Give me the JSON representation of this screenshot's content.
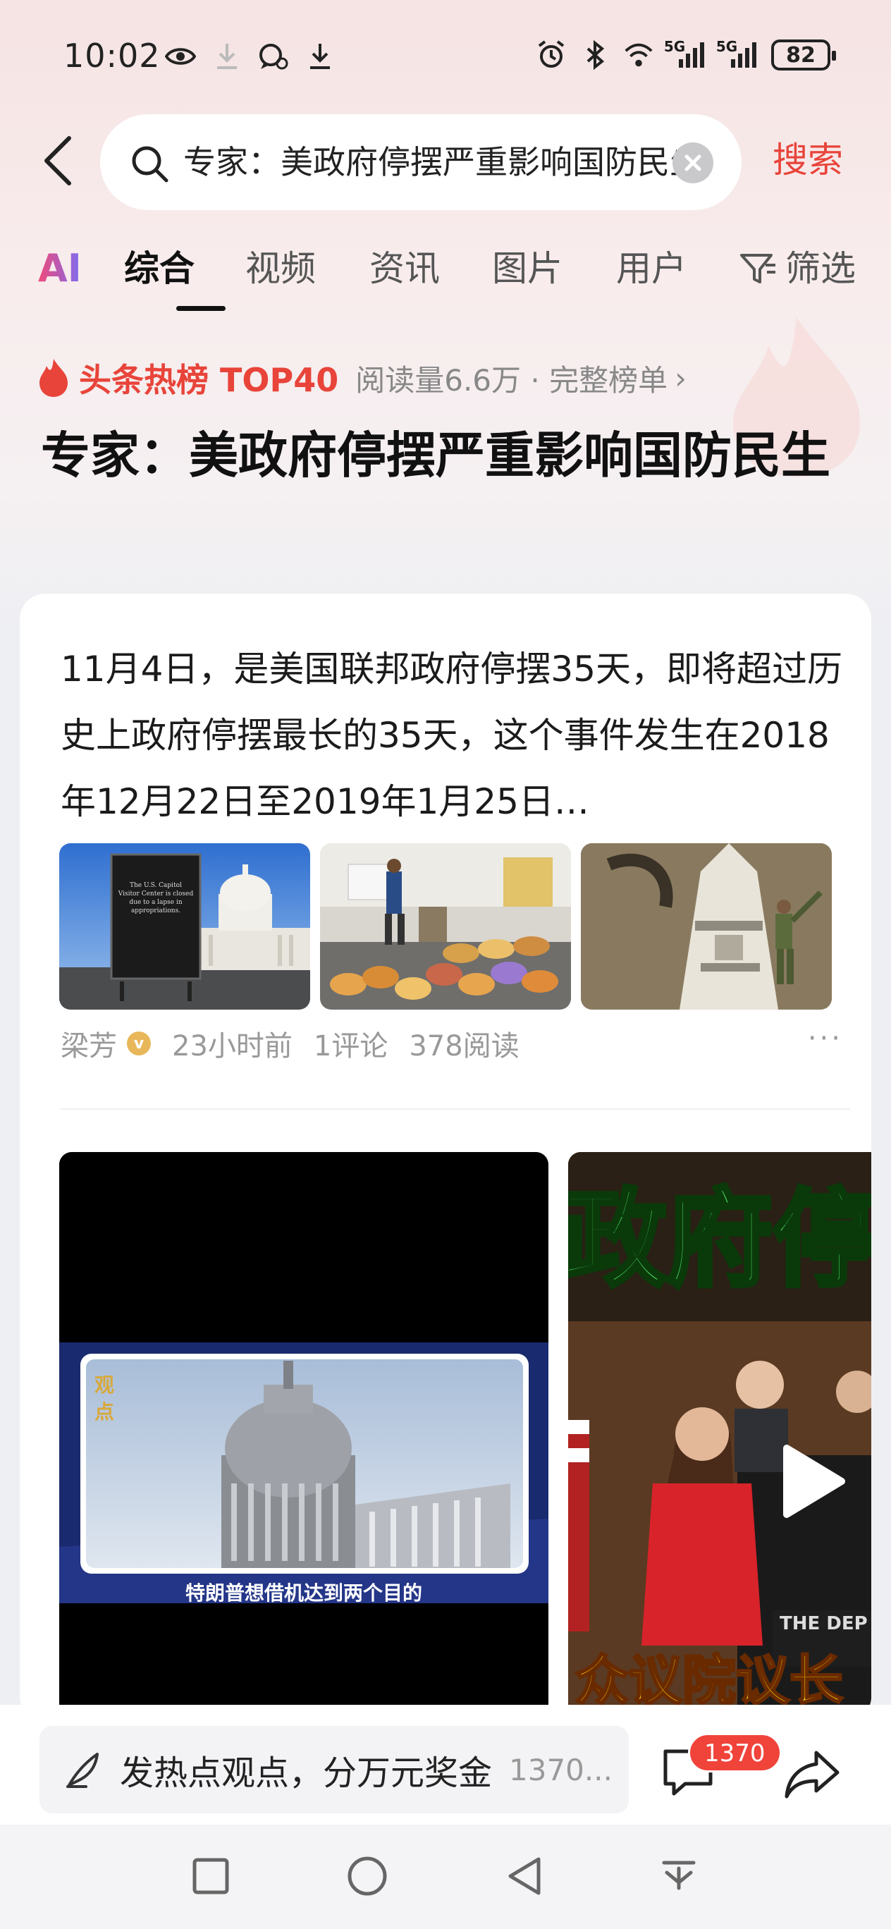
{
  "status_bar": {
    "time": "10:02",
    "network_1": "5G",
    "network_2": "5G",
    "battery": "82"
  },
  "search": {
    "query": "专家：美政府停摆严重影响国防民生",
    "button": "搜索"
  },
  "tabs": {
    "ai": "AI",
    "items": [
      "综合",
      "视频",
      "资讯",
      "图片",
      "用户"
    ],
    "filter": "筛选"
  },
  "hot_rank": {
    "title": "头条热榜 TOP40",
    "meta": "阅读量6.6万 · 完整榜单"
  },
  "headline": "专家：美政府停摆严重影响国防民生",
  "article": {
    "summary": "11月4日，是美国联邦政府停摆35天，即将超过历史上政府停摆最长的35天，这个事件发生在2018年12月22日至2019年1月25日…",
    "thumbnails": [
      {
        "name": "capitol-sign-image",
        "sign_text": "The U.S. Capitol Visitor Center is closed due to a lapse in appropriations."
      },
      {
        "name": "food-bank-image"
      },
      {
        "name": "rocket-image"
      }
    ],
    "author": "梁芳",
    "verified_badge": "v",
    "time": "23小时前",
    "comments": "1评论",
    "reads": "378阅读",
    "more": "···"
  },
  "videos": [
    {
      "logo_text": "观\n点",
      "caption": "特朗普想借机达到两个目的"
    },
    {
      "overlay_top": "政府停",
      "overlay_bottom": "众议院议长",
      "podium_text": "THE DEP"
    }
  ],
  "bottom_bar": {
    "comment_placeholder": "发热点观点，分万元奖金",
    "comment_count_hint": "1370...",
    "badge_count": "1370"
  },
  "colors": {
    "accent": "#e8443a",
    "badge": "#f0433a"
  }
}
